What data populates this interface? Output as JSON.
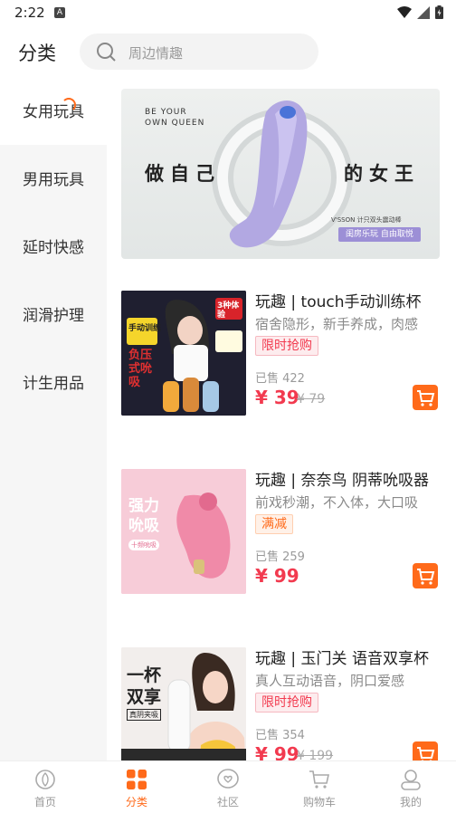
{
  "status": {
    "time": "2:22"
  },
  "header": {
    "title": "分类",
    "search_placeholder": "周边情趣"
  },
  "sidebar": {
    "items": [
      {
        "label": "女用玩具",
        "active": true
      },
      {
        "label": "男用玩具"
      },
      {
        "label": "延时快感"
      },
      {
        "label": "润滑护理"
      },
      {
        "label": "计生用品"
      }
    ]
  },
  "banner": {
    "kicker_line1": "BE YOUR",
    "kicker_line2": "OWN QUEEN",
    "left_text": "做自己",
    "right_text": "的女王",
    "brand": "V'SSON 计只双头震动棒",
    "tag": "闺房乐玩 自由取悦"
  },
  "products": [
    {
      "name": "玩趣 | touch手动训练杯",
      "desc": "宿舍隐形，新手养成，肉感",
      "badge": "限时抢购",
      "sold": "已售 422",
      "price": "¥ 39",
      "orig": "¥ 79",
      "img_text": {
        "t1": "手动训练",
        "t2": "3种体验",
        "t3": "负压式吮吸"
      }
    },
    {
      "name": "玩趣 | 奈奈鸟 阴蒂吮吸器",
      "desc": "前戏秒潮，不入体，大口吸",
      "badge": "满减",
      "sold": "已售 259",
      "price": "¥ 99",
      "orig": "",
      "img_text": {
        "t1": "强力",
        "t2": "吮吸",
        "t3": "十频吮吸"
      }
    },
    {
      "name": "玩趣 | 玉门关 语音双享杯",
      "desc": "真人互动语音，阴口爱感",
      "badge": "限时抢购",
      "sold": "已售 354",
      "price": "¥ 99",
      "orig": "¥ 199",
      "img_text": {
        "t1": "一杯",
        "t2": "双享",
        "t3": "真阴夹吸"
      }
    }
  ],
  "tabbar": {
    "items": [
      {
        "label": "首页",
        "icon": "home-icon"
      },
      {
        "label": "分类",
        "icon": "category-icon",
        "active": true
      },
      {
        "label": "社区",
        "icon": "community-icon"
      },
      {
        "label": "购物车",
        "icon": "cart-icon"
      },
      {
        "label": "我的",
        "icon": "profile-icon"
      }
    ]
  },
  "colors": {
    "accent": "#ff6a1a",
    "price": "#f23a4f"
  }
}
